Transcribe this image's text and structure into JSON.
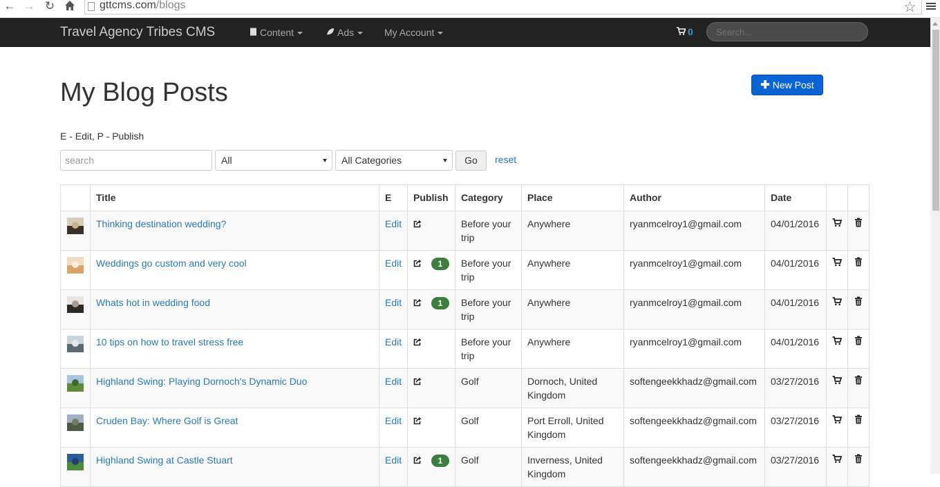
{
  "browser": {
    "url_domain": "gttcms.com",
    "url_path": "/blogs"
  },
  "navbar": {
    "brand": "Travel Agency Tribes CMS",
    "menu": [
      {
        "label": "Content",
        "icon": "file-icon"
      },
      {
        "label": "Ads",
        "icon": "leaf-icon"
      },
      {
        "label": "My Account",
        "icon": ""
      }
    ],
    "cart_count": "0",
    "search_placeholder": "Search..."
  },
  "page": {
    "title": "My Blog Posts",
    "new_post_label": "New Post",
    "legend": "E - Edit, P - Publish"
  },
  "filters": {
    "search_placeholder": "search",
    "status_value": "All",
    "category_value": "All Categories",
    "go_label": "Go",
    "reset_label": "reset"
  },
  "table": {
    "headers": [
      "",
      "Title",
      "E",
      "Publish",
      "Category",
      "Place",
      "Author",
      "Date",
      "",
      ""
    ],
    "edit_label": "Edit",
    "rows": [
      {
        "title": "Thinking destination wedding?",
        "badge": "",
        "category": "Before your trip",
        "place": "Anywhere",
        "author": "ryanmcelroy1@gmail.com",
        "date": "04/01/2016",
        "thumb_colors": [
          "#d8cdb8",
          "#3a3028",
          "#c9b28a"
        ]
      },
      {
        "title": "Weddings go custom and very cool",
        "badge": "1",
        "category": "Before your trip",
        "place": "Anywhere",
        "author": "ryanmcelroy1@gmail.com",
        "date": "04/01/2016",
        "thumb_colors": [
          "#f2dcc0",
          "#d9a36a",
          "#fbeedd"
        ]
      },
      {
        "title": "Whats hot in wedding food",
        "badge": "1",
        "category": "Before your trip",
        "place": "Anywhere",
        "author": "ryanmcelroy1@gmail.com",
        "date": "04/01/2016",
        "thumb_colors": [
          "#e8e4df",
          "#2e2a28",
          "#a59c93"
        ]
      },
      {
        "title": "10 tips on how to travel stress free",
        "badge": "",
        "category": "Before your trip",
        "place": "Anywhere",
        "author": "ryanmcelroy1@gmail.com",
        "date": "04/01/2016",
        "thumb_colors": [
          "#c9d3dc",
          "#5b6a74",
          "#e4e8ec"
        ]
      },
      {
        "title": "Highland Swing: Playing Dornoch's Dynamic Duo",
        "badge": "",
        "category": "Golf",
        "place": "Dornoch, United Kingdom",
        "author": "softengeekkhadz@gmail.com",
        "date": "03/27/2016",
        "thumb_colors": [
          "#a8c4e0",
          "#5f8c3a",
          "#3f6a2a"
        ]
      },
      {
        "title": "Cruden Bay: Where Golf is Great",
        "badge": "",
        "category": "Golf",
        "place": "Port Erroll, United Kingdom",
        "author": "softengeekkhadz@gmail.com",
        "date": "03/27/2016",
        "thumb_colors": [
          "#9fb1c3",
          "#4d5a44",
          "#6f7c5e"
        ]
      },
      {
        "title": "Highland Swing at Castle Stuart",
        "badge": "1",
        "category": "Golf",
        "place": "Inverness, United Kingdom",
        "author": "softengeekkhadz@gmail.com",
        "date": "03/27/2016",
        "thumb_colors": [
          "#2d5d9a",
          "#4c8a3c",
          "#1e3f6b"
        ]
      }
    ]
  }
}
